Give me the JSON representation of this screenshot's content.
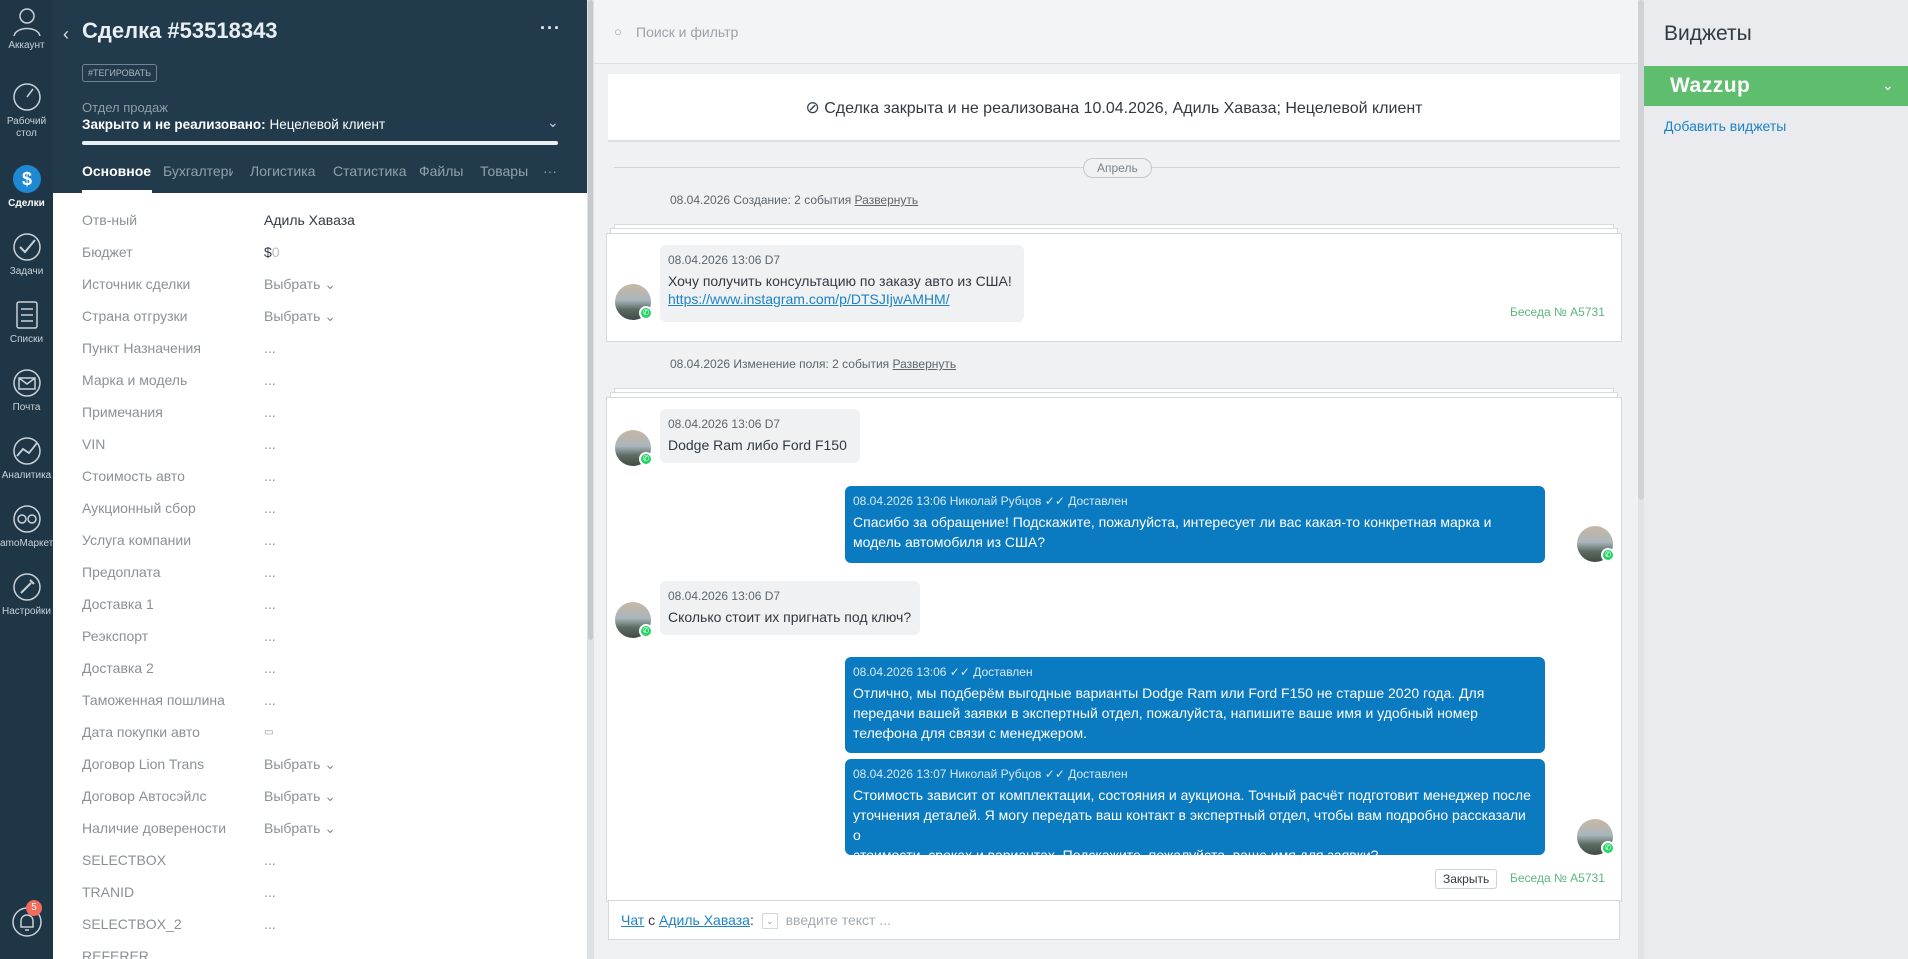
{
  "nav": {
    "items": [
      {
        "label": "Аккаунт",
        "icon": "account-icon"
      },
      {
        "label": "Рабочий стол",
        "icon": "dashboard-icon"
      },
      {
        "label": "Сделки",
        "icon": "deals-icon"
      },
      {
        "label": "Задачи",
        "icon": "tasks-icon"
      },
      {
        "label": "Списки",
        "icon": "lists-icon"
      },
      {
        "label": "Почта",
        "icon": "mail-icon"
      },
      {
        "label": "Аналитика",
        "icon": "analytics-icon"
      },
      {
        "label": "amoМаркет",
        "icon": "market-icon"
      },
      {
        "label": "Настройки",
        "icon": "settings-icon"
      }
    ],
    "notifications_badge": "5"
  },
  "deal": {
    "title": "Сделка #53518343",
    "tag_button": "#ТЕГИРОВАТЬ",
    "pipeline": "Отдел продаж",
    "status_bold": "Закрыто и не реализовано:",
    "status_reason": "Нецелевой клиент",
    "tabs": [
      "Основное",
      "Бухгалтерия",
      "Логистика",
      "Статистика",
      "Файлы",
      "Товары"
    ],
    "fields": [
      {
        "label": "Отв-ный",
        "value": "Адиль Хаваза"
      },
      {
        "label": "Бюджет",
        "currency": "$",
        "value": "0"
      },
      {
        "label": "Источник сделки",
        "value": "Выбрать"
      },
      {
        "label": "Страна отгрузки",
        "value": "Выбрать"
      },
      {
        "label": "Пункт Назначения",
        "value": "..."
      },
      {
        "label": "Марка и модель",
        "value": "..."
      },
      {
        "label": "Примечания",
        "value": "..."
      },
      {
        "label": "VIN",
        "value": "..."
      },
      {
        "label": "Стоимость авто",
        "value": "..."
      },
      {
        "label": "Аукционный сбор",
        "value": "..."
      },
      {
        "label": "Услуга компании",
        "value": "..."
      },
      {
        "label": "Предоплата",
        "value": "..."
      },
      {
        "label": "Доставка 1",
        "value": "..."
      },
      {
        "label": "Реэкспорт",
        "value": "..."
      },
      {
        "label": "Доставка 2",
        "value": "..."
      },
      {
        "label": "Таможенная пошлина",
        "value": "..."
      },
      {
        "label": "Дата покупки авто",
        "value": "▭"
      },
      {
        "label": "Договор Lion Trans",
        "value": "Выбрать"
      },
      {
        "label": "Договор Автосэйлс",
        "value": "Выбрать"
      },
      {
        "label": "Наличие доверености",
        "value": "Выбрать"
      },
      {
        "label": "SELECTBOX",
        "value": "..."
      },
      {
        "label": "TRANID",
        "value": "..."
      },
      {
        "label": "SELECTBOX_2",
        "value": "..."
      },
      {
        "label": "REFERER",
        "value": ""
      }
    ]
  },
  "feed": {
    "search_placeholder": "Поиск и фильтр",
    "closed_banner": "Сделка закрыта и не реализована 10.04.2026, Адиль Хаваза; Нецелевой клиент",
    "month": "Апрель",
    "event1": {
      "text": "08.04.2026 Создание: 2 события",
      "link": "Развернуть"
    },
    "event2": {
      "text": "08.04.2026 Изменение поля: 2 события",
      "link": "Развернуть"
    },
    "conversation_label": "Беседа № A5731",
    "close_label": "Закрыть",
    "messages": [
      {
        "meta": "08.04.2026 13:06 D7",
        "text": "Хочу получить консультацию по заказу авто из США!",
        "link": "https://www.instagram.com/p/DTSJIjwAMHM/"
      },
      {
        "meta": "08.04.2026 13:06 D7",
        "text": "Dodge Ram либо Ford F150"
      },
      {
        "meta": "08.04.2026 13:06 Николай Рубцов",
        "status": "Доставлен",
        "text1": "Спасибо за обращение! Подскажите, пожалуйста, интересует ли вас какая-то конкретная марка и",
        "text2": "модель автомобиля из США?"
      },
      {
        "meta": "08.04.2026 13:06 D7",
        "text": "Сколько стоит их пригнать под ключ?"
      },
      {
        "meta": "08.04.2026 13:06",
        "status": "Доставлен",
        "text1": "Отлично, мы подберём выгодные варианты Dodge Ram или Ford F150 не старше 2020 года. Для",
        "text2": "передачи вашей заявки в экспертный отдел, пожалуйста, напишите ваше имя и удобный номер",
        "text3": "телефона для связи с менеджером."
      },
      {
        "meta": "08.04.2026 13:07 Николай Рубцов",
        "status": "Доставлен",
        "text1": "Стоимость зависит от комплектации, состояния и аукциона. Точный расчёт подготовит менеджер после",
        "text2": "уточнения деталей. Я могу передать ваш контакт в экспертный отдел, чтобы вам подробно рассказали о",
        "text3": "стоимости, сроках и вариантах. Подскажите, пожалуйста, ваше имя для заявки?"
      }
    ],
    "chat": {
      "chat_link": "Чат",
      "with": "с",
      "contact": "Адиль Хаваза",
      "colon": ":",
      "placeholder": "введите текст ..."
    }
  },
  "widgets": {
    "title": "Виджеты",
    "wazzup": "Wazzup",
    "add": "Добавить виджеты"
  },
  "colors": {
    "nav_bg": "#1f3646",
    "header_bg": "#213b4c",
    "outgoing": "#0b7bc1",
    "wazzup": "#5fbe6e",
    "link": "#1d83c6"
  }
}
